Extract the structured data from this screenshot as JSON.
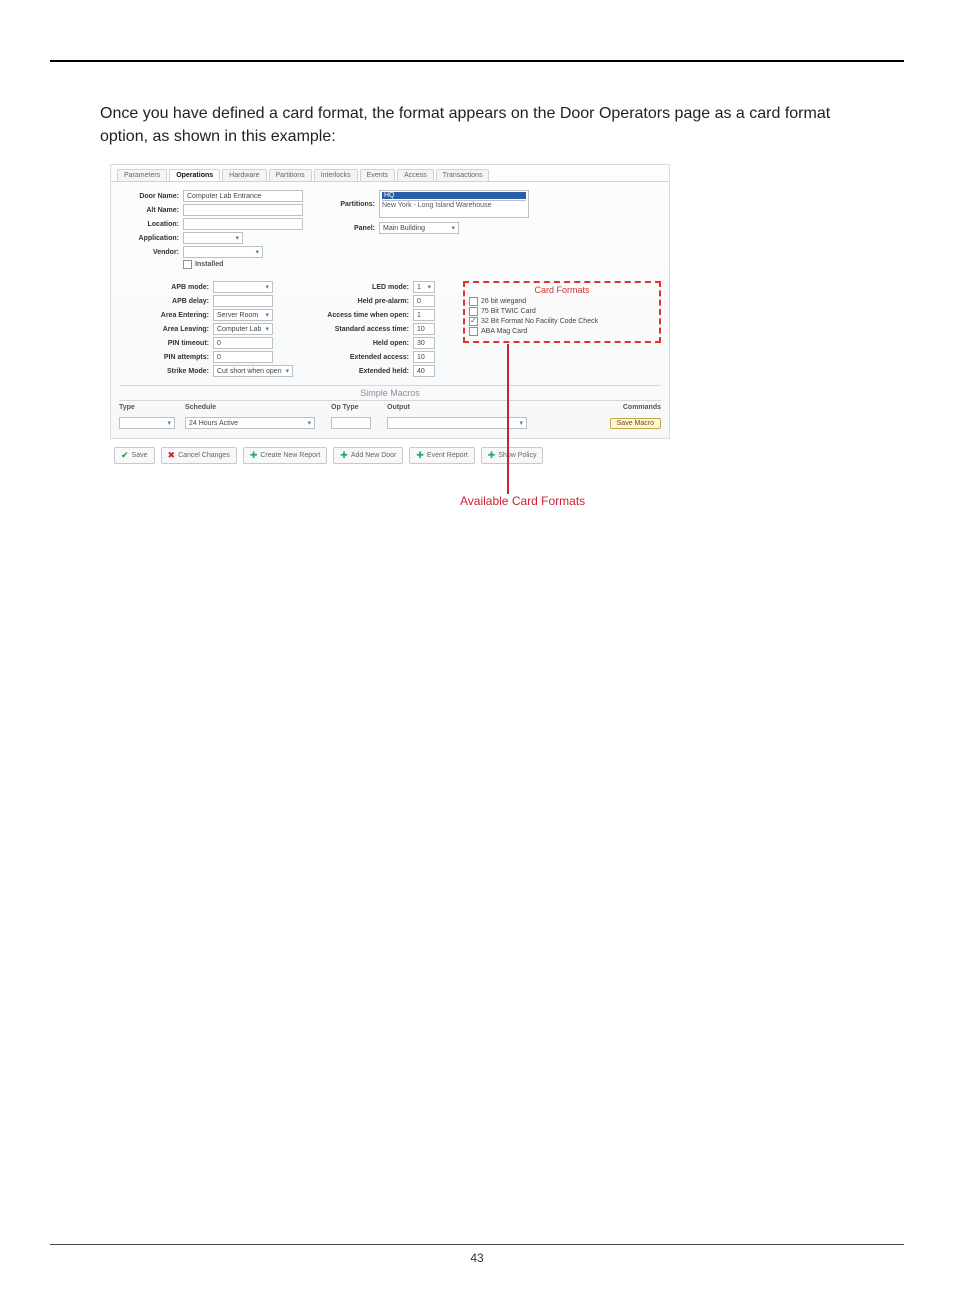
{
  "page": {
    "intro": "Once you have defined a card format, the format appears on the Door Operators page as a card format option, as shown in this example:",
    "page_number": "43"
  },
  "annotations": {
    "card_formats_title": "Card Formats",
    "available_label": "Available Card Formats"
  },
  "tabs": {
    "items": [
      "Parameters",
      "Operations",
      "Hardware",
      "Partitions",
      "Interlocks",
      "Events",
      "Access",
      "Transactions"
    ]
  },
  "left": {
    "door_name_l": "Door Name:",
    "door_name_v": "Computer Lab Entrance",
    "alt_name_l": "Alt Name:",
    "alt_name_v": "",
    "location_l": "Location:",
    "location_v": "",
    "application_l": "Application:",
    "application_v": "",
    "vendor_l": "Vendor:",
    "vendor_v": "",
    "installed_l": "Installed"
  },
  "partitions": {
    "label": "Partitions:",
    "sel": "HQ",
    "other": "New York - Long Island Warehouse",
    "panel_l": "Panel:",
    "panel_v": "Main Building"
  },
  "mid_left": {
    "apb_mode_l": "APB mode:",
    "apb_mode_v": "",
    "apb_delay_l": "APB delay:",
    "apb_delay_v": "",
    "area_ent_l": "Area Entering:",
    "area_ent_v": "Server Room",
    "area_lev_l": "Area Leaving:",
    "area_lev_v": "Computer Lab",
    "pin_to_l": "PIN timeout:",
    "pin_to_v": "0",
    "pin_att_l": "PIN attempts:",
    "pin_att_v": "0",
    "strike_l": "Strike Mode:",
    "strike_v": "Cut short when open"
  },
  "mid_right": {
    "led_l": "LED mode:",
    "led_v": "1",
    "held_l": "Held pre-alarm:",
    "held_v": "0",
    "atime_l": "Access time when open:",
    "atime_v": "1",
    "stime_l": "Standard access time:",
    "stime_v": "10",
    "hopen_l": "Held open:",
    "hopen_v": "30",
    "exta_l": "Extended access:",
    "exta_v": "10",
    "exth_l": "Extended held:",
    "exth_v": "40"
  },
  "card_formats": {
    "items": [
      {
        "checked": false,
        "label": "26 bit wiegand"
      },
      {
        "checked": false,
        "label": "75 Bit TWIC Card"
      },
      {
        "checked": true,
        "label": "32 Bit Format No Facility Code Check"
      },
      {
        "checked": false,
        "label": "ABA Mag Card"
      }
    ]
  },
  "macros": {
    "title": "Simple Macros",
    "h_type": "Type",
    "h_sched": "Schedule",
    "h_optype": "Op Type",
    "h_output": "Output",
    "h_commands": "Commands",
    "row": {
      "type_v": "",
      "sched_v": "24 Hours Active",
      "optype_v": "",
      "output_v": "",
      "save_label": "Save Macro"
    }
  },
  "actions": {
    "save": "Save",
    "cancel": "Cancel Changes",
    "create_report": "Create New Report",
    "add_door": "Add New Door",
    "event_report": "Event Report",
    "show_policy": "Show Policy"
  }
}
